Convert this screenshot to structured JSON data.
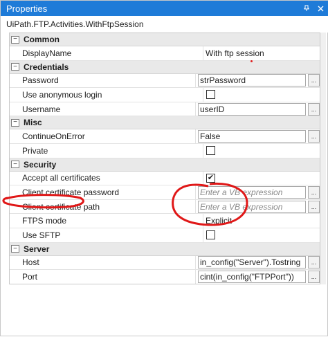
{
  "window": {
    "title": "Properties",
    "pin_icon": "pin-icon",
    "close_icon": "close-icon"
  },
  "activity_type": "UiPath.FTP.Activities.WithFtpSession",
  "categories": [
    {
      "name": "Common",
      "toggle": "−",
      "rows": [
        {
          "name": "DisplayName",
          "kind": "text",
          "value": "With ftp session"
        }
      ]
    },
    {
      "name": "Credentials",
      "toggle": "−",
      "rows": [
        {
          "name": "Password",
          "kind": "textbox",
          "value": "strPassword",
          "button": "..."
        },
        {
          "name": "Use anonymous login",
          "kind": "checkbox",
          "checked": false
        },
        {
          "name": "Username",
          "kind": "textbox",
          "value": "userID",
          "button": "..."
        }
      ]
    },
    {
      "name": "Misc",
      "toggle": "−",
      "rows": [
        {
          "name": "ContinueOnError",
          "kind": "textbox",
          "value": "False",
          "button": "..."
        },
        {
          "name": "Private",
          "kind": "checkbox",
          "checked": false
        }
      ]
    },
    {
      "name": "Security",
      "toggle": "−",
      "rows": [
        {
          "name": "Accept all certificates",
          "kind": "checkbox",
          "checked": true,
          "check_mark": "✔"
        },
        {
          "name": "Client certificate password",
          "kind": "placeholder",
          "value": "Enter a VB expression",
          "button": "..."
        },
        {
          "name": "Client certificate path",
          "kind": "placeholder",
          "value": "Enter a VB expression",
          "button": "..."
        },
        {
          "name": "FTPS mode",
          "kind": "text",
          "value": "Explicit"
        },
        {
          "name": "Use SFTP",
          "kind": "checkbox",
          "checked": false
        }
      ]
    },
    {
      "name": "Server",
      "toggle": "−",
      "rows": [
        {
          "name": "Host",
          "kind": "textbox",
          "value": "in_config(\"Server\").Tostring",
          "button": "..."
        },
        {
          "name": "Port",
          "kind": "textbox",
          "value": "cint(in_config(\"FTPPort\"))",
          "button": "..."
        }
      ]
    }
  ],
  "colors": {
    "titlebar": "#1e7bd8",
    "category_bg": "#e9e9e9",
    "annotation_red": "#e01818"
  }
}
